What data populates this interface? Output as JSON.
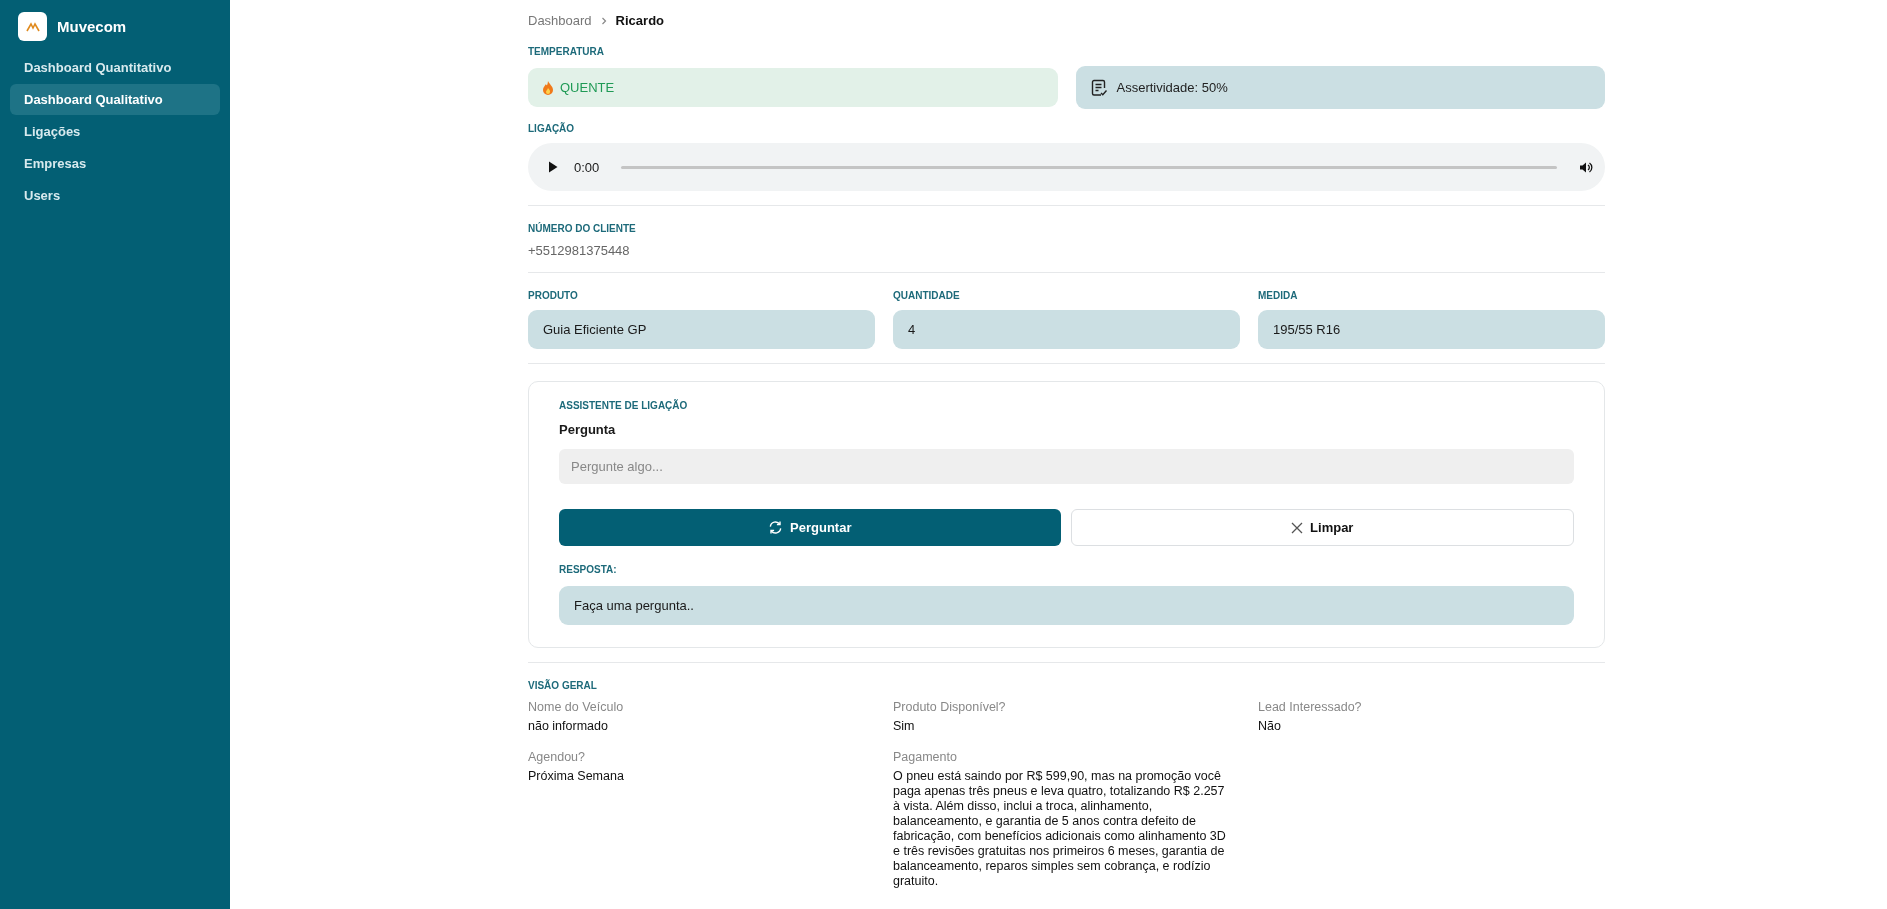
{
  "sidebar": {
    "brand": "Muvecom",
    "items": [
      {
        "label": "Dashboard Quantitativo",
        "selected": false
      },
      {
        "label": "Dashboard Qualitativo",
        "selected": true
      },
      {
        "label": "Ligações",
        "selected": false
      },
      {
        "label": "Empresas",
        "selected": false
      },
      {
        "label": "Users",
        "selected": false
      }
    ]
  },
  "breadcrumb": [
    "Dashboard",
    "Ricardo"
  ],
  "temperature": {
    "label": "TEMPERATURA",
    "value": "QUENTE",
    "kind": "hot",
    "accuracy": "Assertividade: 50%"
  },
  "call": {
    "label": "LIGAÇÃO",
    "time": "0:00",
    "level": 0
  },
  "client_number": {
    "label": "NÚMERO DO CLIENTE",
    "value": "+5512981375448"
  },
  "fields": [
    {
      "label": "PRODUTO",
      "value": "Guia Eficiente GP"
    },
    {
      "label": "QUANTIDADE",
      "value": "4"
    },
    {
      "label": "MEDIDA",
      "value": "195/55 R16"
    }
  ],
  "assistant": {
    "title": "ASSISTENTE DE LIGAÇÃO",
    "question_label": "Pergunta",
    "placeholder": "Pergunte algo...",
    "ask_button": "Perguntar",
    "clear_button": "Limpar",
    "answer_label": "RESPOSTA:",
    "answer": "Faça uma pergunta.."
  },
  "overview": {
    "title": "VISÃO GERAL",
    "items": [
      {
        "label": "Nome do Veículo",
        "value": "não informado"
      },
      {
        "label": "Produto Disponível?",
        "value": "Sim"
      },
      {
        "label": "Lead Interessado?",
        "value": "Não"
      },
      {
        "label": "Agendou?",
        "value": "Próxima Semana"
      },
      {
        "label": "Pagamento",
        "value": "O pneu está saindo por R$ 599,90, mas na promoção você paga apenas três pneus e leva quatro, totalizando R$ 2.257 à vista. Além disso, inclui a troca, alinhamento, balanceamento, e garantia de 5 anos contra defeito de fabricação, com benefícios adicionais como alinhamento 3D e três revisões gratuitas nos primeiros 6 meses, garantia de balanceamento, reparos simples sem cobrança, e rodízio gratuito."
      }
    ]
  }
}
